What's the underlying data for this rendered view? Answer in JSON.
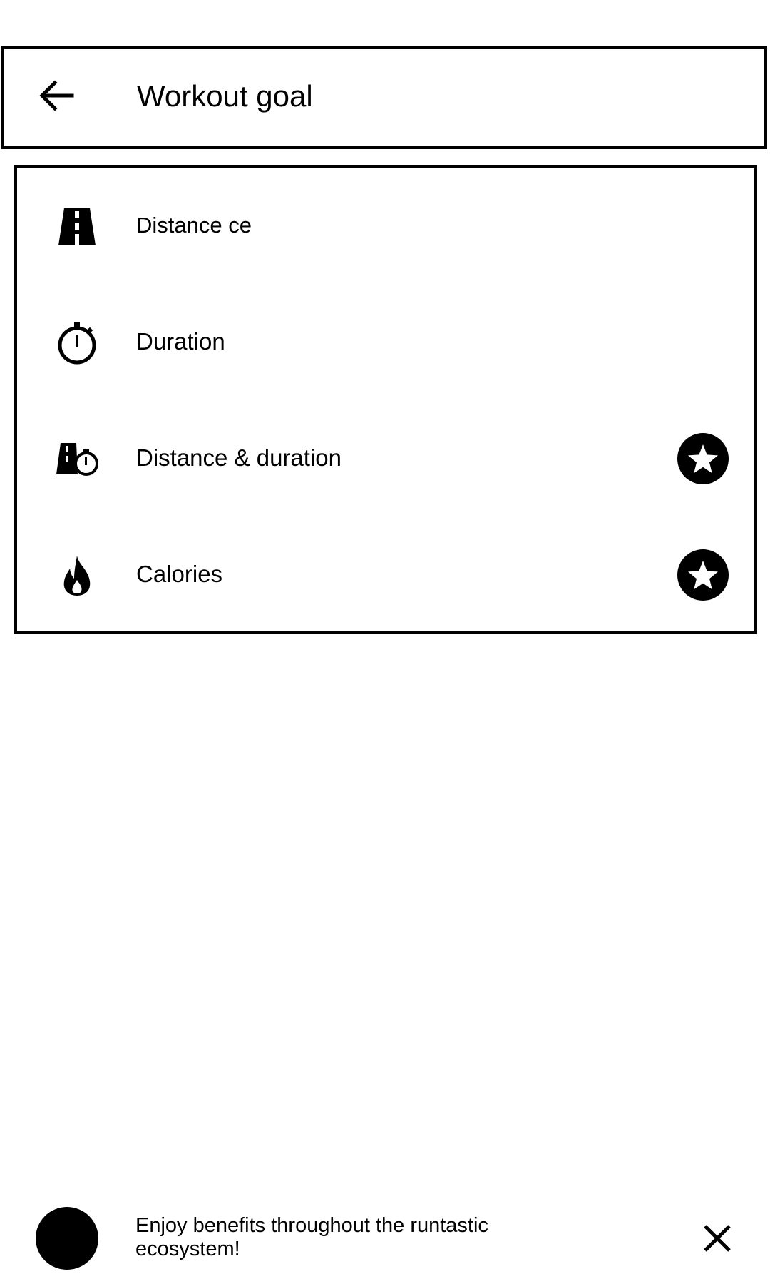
{
  "header": {
    "title": "Workout goal",
    "back_icon": "arrow-left-icon"
  },
  "goals": [
    {
      "label": "Distance ce",
      "icon": "road-icon",
      "premium": false
    },
    {
      "label": "Duration",
      "icon": "stopwatch-icon",
      "premium": false
    },
    {
      "label": "Distance & duration",
      "icon": "road-stopwatch-icon",
      "premium": true
    },
    {
      "label": "Calories",
      "icon": "flame-icon",
      "premium": true
    }
  ],
  "premium_icon": "star-icon",
  "promo": {
    "text": "Enjoy benefits throughout the runtastic ecosystem!",
    "close_icon": "close-icon"
  }
}
